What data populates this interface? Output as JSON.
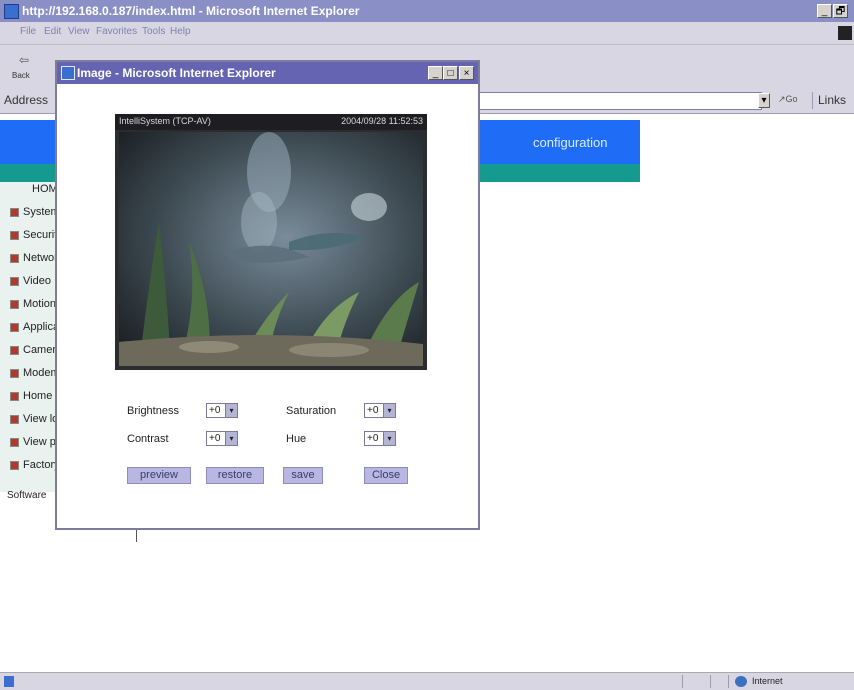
{
  "main_window": {
    "title": "http://192.168.0.187/index.html - Microsoft Internet Explorer",
    "controls": [
      "_",
      "🗗",
      "×"
    ],
    "menu": [
      "File",
      "Edit",
      "View",
      "Favorites",
      "Tools",
      "Help"
    ],
    "back_label": "Back",
    "address_label": "Address",
    "go_label": "Go",
    "links_label": "Links"
  },
  "page": {
    "config_label": "configuration",
    "nav_items": [
      "HOME",
      "System",
      "Security",
      "Network",
      "Video",
      "Motion",
      "Application",
      "Camera",
      "Modem",
      "Home page",
      "View log",
      "View parameters",
      "Factory default"
    ],
    "software_label": "Software"
  },
  "status": {
    "left_icon": "page-icon",
    "zone": "Internet"
  },
  "popup": {
    "title": "Image - Microsoft Internet Explorer",
    "camera_label": "IntelliSystem (TCP-AV)",
    "camera_timestamp": "2004/09/28 11:52:53",
    "controls": {
      "brightness_label": "Brightness",
      "brightness_value": "+0",
      "saturation_label": "Saturation",
      "saturation_value": "+0",
      "contrast_label": "Contrast",
      "contrast_value": "+0",
      "hue_label": "Hue",
      "hue_value": "+0"
    },
    "buttons": {
      "preview": "preview",
      "restore": "restore",
      "save": "save",
      "close": "Close"
    }
  },
  "colors": {
    "title_bar": "#8a8fc6",
    "popup_title_bar": "#6564b2",
    "page_blue": "#1f6df6",
    "page_teal": "#149a8e",
    "button_fill": "#b9b6e2"
  }
}
